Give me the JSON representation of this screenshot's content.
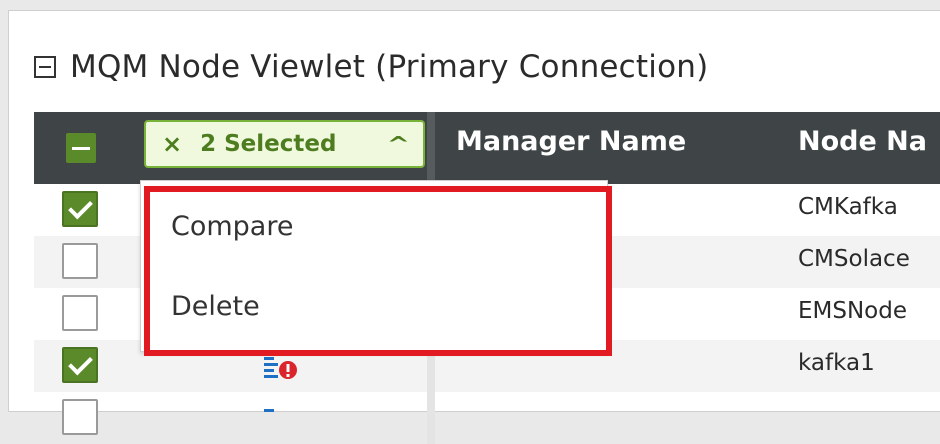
{
  "viewlet": {
    "title": "MQM Node Viewlet (Primary Connection)"
  },
  "toolbar": {
    "selection_close": "×",
    "selection_label": "2 Selected",
    "selection_chevron": "^"
  },
  "columns": {
    "manager_name": "Manager Name",
    "node_name": "Node Na"
  },
  "rows": [
    {
      "checked": true,
      "node": "CMKafka"
    },
    {
      "checked": false,
      "node": "CMSolace"
    },
    {
      "checked": false,
      "node": "EMSNode"
    },
    {
      "checked": true,
      "node": "kafka1"
    },
    {
      "checked": false,
      "node": ""
    }
  ],
  "menu": {
    "items": [
      "Compare",
      "Delete"
    ]
  },
  "colors": {
    "accent_green": "#5b8a2a",
    "header_bg": "#3f4547",
    "highlight_red": "#e21b22",
    "icon_blue": "#1f6fc5",
    "icon_red": "#d9252b"
  }
}
